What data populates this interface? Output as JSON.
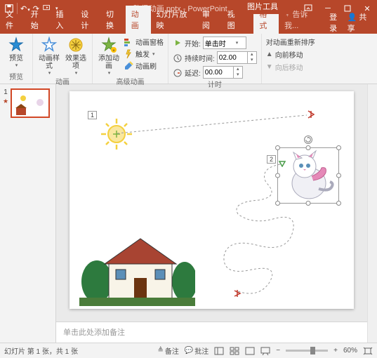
{
  "app": {
    "document_title": "路径动画.pptx - PowerPoint",
    "picture_tools_label": "图片工具"
  },
  "qat": {
    "save": "保存",
    "undo": "撤消",
    "redo": "恢复",
    "start": "从头开始"
  },
  "tabs": {
    "file": "文件",
    "home": "开始",
    "insert": "插入",
    "design": "设计",
    "transitions": "切换",
    "animations": "动画",
    "slideshow": "幻灯片放映",
    "review": "审阅",
    "view": "视图",
    "format": "格式"
  },
  "tell_me": "告诉我...",
  "login": "登录",
  "share": "共享",
  "ribbon": {
    "preview": {
      "label": "预览",
      "group": "预览"
    },
    "animation": {
      "styles": "动画样式",
      "effect_options": "效果选项",
      "group": "动画"
    },
    "advanced": {
      "add_animation": "添加动画",
      "animation_pane": "动画窗格",
      "trigger": "触发",
      "painter": "动画刷",
      "group": "高级动画"
    },
    "timing": {
      "start_label": "开始:",
      "start_value": "单击时",
      "duration_label": "持续时间:",
      "duration_value": "02.00",
      "delay_label": "延迟:",
      "delay_value": "00.00",
      "group": "计时"
    },
    "reorder": {
      "title": "对动画重新排序",
      "earlier": "向前移动",
      "later": "向后移动"
    }
  },
  "thumbnail": {
    "number": "1",
    "star": "★"
  },
  "slide": {
    "anim_tag_1": "1",
    "anim_tag_2": "2"
  },
  "notes_placeholder": "单击此处添加备注",
  "status": {
    "slide_info": "幻灯片 第 1 张，共 1 张",
    "notes": "备注",
    "comments": "批注",
    "zoom_value": "60%",
    "minus": "−",
    "plus": "+"
  }
}
